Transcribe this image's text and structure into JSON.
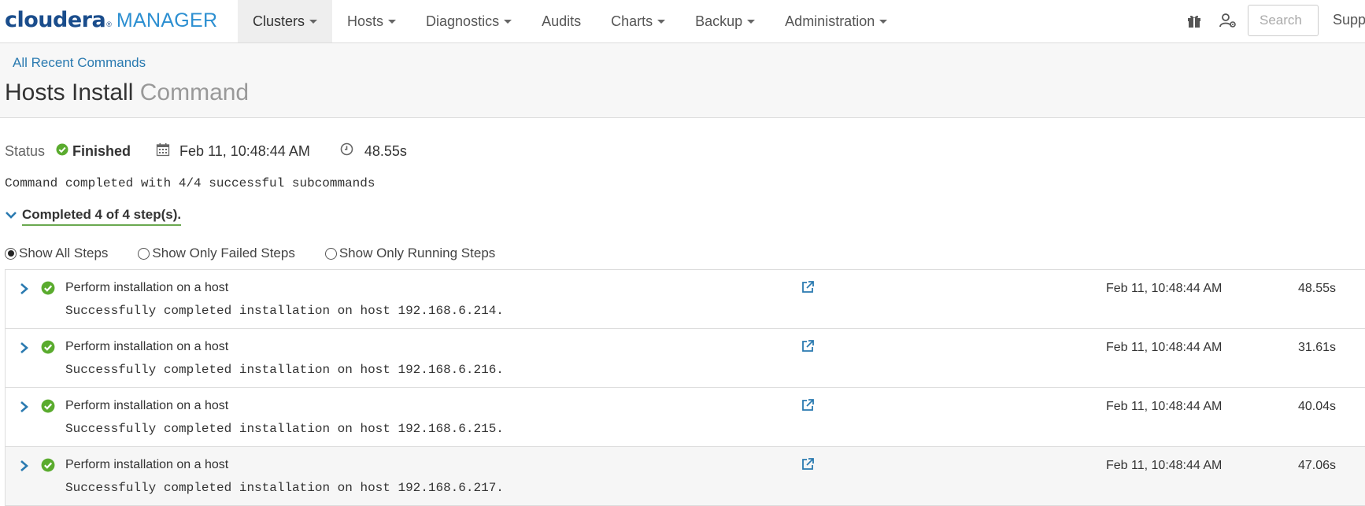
{
  "navbar": {
    "logo_primary": "cloudera",
    "logo_reg": "®",
    "logo_secondary": "MANAGER",
    "items": [
      {
        "label": "Clusters",
        "dropdown": true,
        "active": true
      },
      {
        "label": "Hosts",
        "dropdown": true
      },
      {
        "label": "Diagnostics",
        "dropdown": true
      },
      {
        "label": "Audits",
        "dropdown": false
      },
      {
        "label": "Charts",
        "dropdown": true
      },
      {
        "label": "Backup",
        "dropdown": true
      },
      {
        "label": "Administration",
        "dropdown": true
      }
    ],
    "icons": [
      "gift-icon",
      "user-settings-icon"
    ],
    "search_placeholder": "Search",
    "support_label": "Supp"
  },
  "header": {
    "breadcrumb": "All Recent Commands",
    "title_main": "Hosts Install",
    "title_sub": "Command"
  },
  "status": {
    "label": "Status",
    "value": "Finished",
    "date": "Feb 11, 10:48:44 AM",
    "duration": "48.55s"
  },
  "message": "Command completed with 4/4 successful subcommands",
  "completed_summary": "Completed 4 of 4 step(s).",
  "filters": [
    {
      "label": "Show All Steps",
      "checked": true
    },
    {
      "label": "Show Only Failed Steps",
      "checked": false
    },
    {
      "label": "Show Only Running Steps",
      "checked": false
    }
  ],
  "steps": [
    {
      "title": "Perform installation on a host",
      "detail": "Successfully completed installation on host 192.168.6.214.",
      "date": "Feb 11, 10:48:44 AM",
      "duration": "48.55s"
    },
    {
      "title": "Perform installation on a host",
      "detail": "Successfully completed installation on host 192.168.6.216.",
      "date": "Feb 11, 10:48:44 AM",
      "duration": "31.61s"
    },
    {
      "title": "Perform installation on a host",
      "detail": "Successfully completed installation on host 192.168.6.215.",
      "date": "Feb 11, 10:48:44 AM",
      "duration": "40.04s"
    },
    {
      "title": "Perform installation on a host",
      "detail": "Successfully completed installation on host 192.168.6.217.",
      "date": "Feb 11, 10:48:44 AM",
      "duration": "47.06s"
    }
  ],
  "colors": {
    "logo_dark": "#1a4d8c",
    "logo_light": "#2c8fd1",
    "link": "#2a7ab0",
    "success": "#5aab2e",
    "chevron": "#2a7ab0"
  }
}
